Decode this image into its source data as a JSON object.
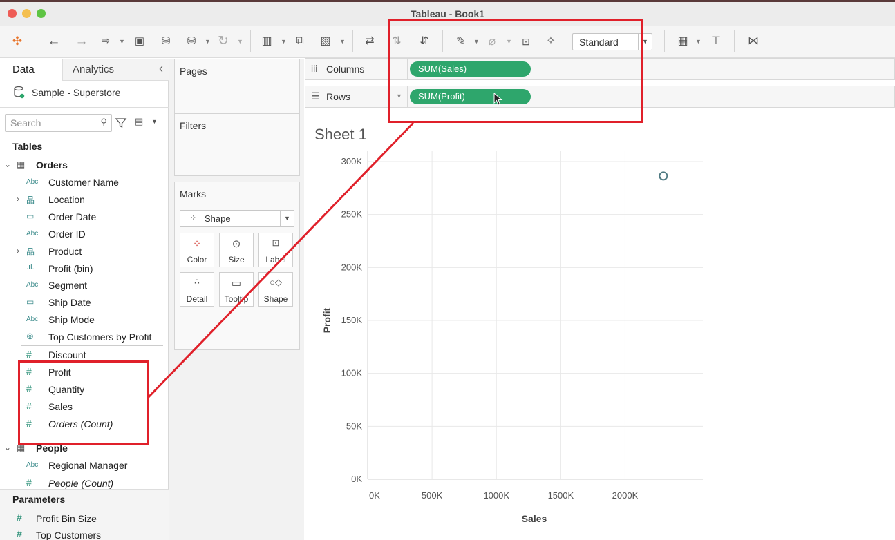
{
  "window": {
    "title": "Tableau - Book1"
  },
  "toolbar": {
    "fit_value": "Standard"
  },
  "left_panel": {
    "tabs": {
      "data": "Data",
      "analytics": "Analytics"
    },
    "datasource": "Sample - Superstore",
    "search_placeholder": "Search",
    "tables_heading": "Tables",
    "orders_table": "Orders",
    "orders_fields": [
      {
        "type": "Abc",
        "name": "Customer Name"
      },
      {
        "type": "hier",
        "name": "Location"
      },
      {
        "type": "date",
        "name": "Order Date"
      },
      {
        "type": "Abc",
        "name": "Order ID"
      },
      {
        "type": "hier",
        "name": "Product"
      },
      {
        "type": "bin",
        "name": "Profit (bin)"
      },
      {
        "type": "Abc",
        "name": "Segment"
      },
      {
        "type": "date",
        "name": "Ship Date"
      },
      {
        "type": "Abc",
        "name": "Ship Mode"
      },
      {
        "type": "set",
        "name": "Top Customers by Profit"
      }
    ],
    "orders_measures": [
      "Discount",
      "Profit",
      "Quantity",
      "Sales",
      "Orders (Count)"
    ],
    "people_table": "People",
    "people_fields": [
      {
        "type": "Abc",
        "name": "Regional Manager"
      }
    ],
    "people_measures": [
      "People (Count)"
    ],
    "parameters_heading": "Parameters",
    "parameters": [
      "Profit Bin Size",
      "Top Customers"
    ]
  },
  "cards": {
    "pages": "Pages",
    "filters": "Filters",
    "marks": "Marks",
    "mark_type": "Shape",
    "mark_buttons": [
      "Color",
      "Size",
      "Label",
      "Detail",
      "Tooltip",
      "Shape"
    ]
  },
  "shelves": {
    "columns": {
      "label": "Columns",
      "pill": "SUM(Sales)"
    },
    "rows": {
      "label": "Rows",
      "pill": "SUM(Profit)"
    }
  },
  "colors": {
    "pill": "#2ea66c",
    "highlight": "#e0202a",
    "mark": "#4f7a82"
  },
  "chart_data": {
    "type": "scatter",
    "title": "Sheet 1",
    "xlabel": "Sales",
    "ylabel": "Profit",
    "xlim": [
      0,
      2500000
    ],
    "ylim": [
      0,
      300000
    ],
    "x_ticks": [
      "0K",
      "500K",
      "1000K",
      "1500K",
      "2000K"
    ],
    "y_ticks": [
      "0K",
      "50K",
      "100K",
      "150K",
      "200K",
      "250K",
      "300K"
    ],
    "points": [
      {
        "x": 2297201,
        "y": 286397
      }
    ],
    "grid": true
  }
}
